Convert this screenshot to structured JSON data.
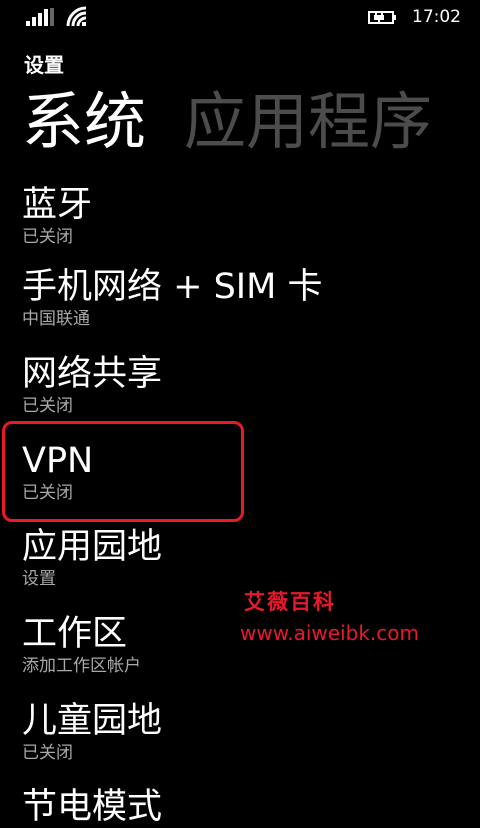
{
  "status_bar": {
    "time": "17:02",
    "signal_icon": "signal-strength-icon",
    "wifi_icon": "wifi-icon",
    "battery_icon": "battery-charging-icon"
  },
  "header": {
    "app_title": "设置",
    "tabs": [
      {
        "label": "系统",
        "active": true
      },
      {
        "label": "应用程序",
        "active": false
      }
    ]
  },
  "settings_list": [
    {
      "name": "蓝牙",
      "status": "已关闭"
    },
    {
      "name": "手机网络 + SIM 卡",
      "status": "中国联通"
    },
    {
      "name": "网络共享",
      "status": "已关闭"
    },
    {
      "name": "VPN",
      "status": "已关闭"
    },
    {
      "name": "应用园地",
      "status": "设置"
    },
    {
      "name": "工作区",
      "status": "添加工作区帐户"
    },
    {
      "name": "儿童园地",
      "status": "已关闭"
    },
    {
      "name": "节电模式",
      "status": ""
    }
  ],
  "watermark": {
    "title": "艾薇百科",
    "url": "www.aiweibk.com"
  },
  "colors": {
    "background": "#000000",
    "text": "#ffffff",
    "subtext": "#a8a8a8",
    "inactive_tab": "#4c4c4c",
    "highlight": "#e8192c"
  }
}
